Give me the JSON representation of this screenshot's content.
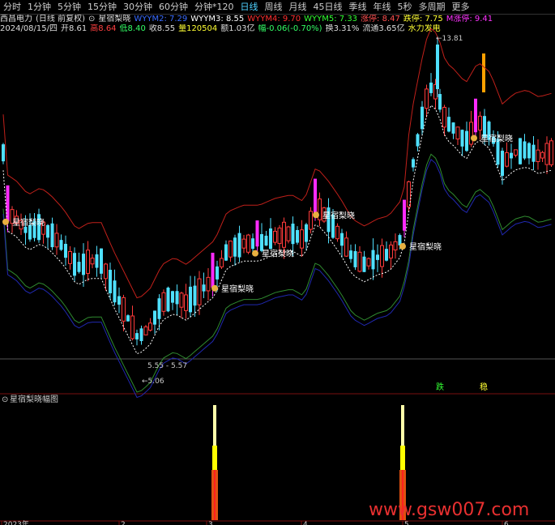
{
  "toolbar": {
    "tabs": [
      "分时",
      "1分钟",
      "5分钟",
      "15分钟",
      "30分钟",
      "60分钟",
      "分钟*120",
      "日线",
      "周线",
      "月线",
      "45日线",
      "季线",
      "年线",
      "5秒",
      "多周期",
      "更多"
    ],
    "active": "日线"
  },
  "info": {
    "stock_name": "西昌电力",
    "period_label": "(日线 前复权)",
    "indicator_name": "星宿梨晓",
    "wyym2": "WYYM2: 7.29",
    "wyym3": "WYYM3: 8.55",
    "wyym4": "WYYM4: 9.70",
    "wyym5": "WYYM5: 7.33",
    "zhangting": "涨停: 8.47",
    "dieting": "跌停: 7.75",
    "m_zhangting": "M涨停: 9.41",
    "date": "2024/08/15/四",
    "open": "开8.61",
    "high": "高8.64",
    "low": "低8.40",
    "close": "收8.55",
    "volume": "量120504",
    "amount": "额1.03亿",
    "change": "幅-0.06(-0.70%)",
    "turnover": "换3.31%",
    "float_cap": "流通3.65亿",
    "sector": "水力发电"
  },
  "colors": {
    "up": "#ff3b3b",
    "down": "#4fe0ff",
    "signal": "#ff2bff",
    "upper_band": "#c0201a",
    "lower_band": "#2f8a2f",
    "blue_band": "#2028b0",
    "mid_line": "#ffffff",
    "accent": "#4fd1ff"
  },
  "chart_data": {
    "type": "candlestick",
    "annotations": {
      "max_label": "13.81",
      "min_label": "5.06",
      "range_label": "5.55 - 5.57",
      "signal_label": "星宿梨晓",
      "die_label": "跌",
      "zhang_label": "稳"
    },
    "sub_panel": {
      "title": "星宿梨晓幅图",
      "type": "bar"
    },
    "x_ticks": [
      "2023年",
      "2",
      "3",
      "4",
      "5",
      "6"
    ],
    "watermark": "www.gsw007.com"
  }
}
